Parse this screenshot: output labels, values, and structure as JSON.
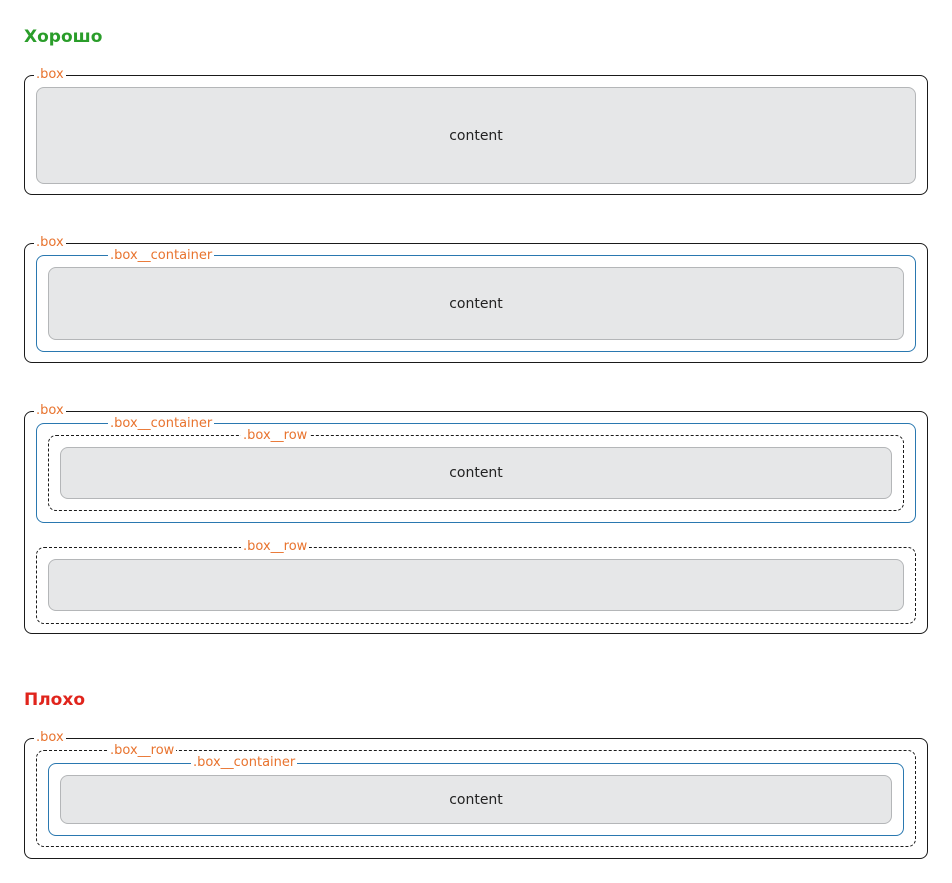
{
  "good": {
    "heading": "Хорошо",
    "heading_color": "#2a9d2a"
  },
  "bad": {
    "heading": "Плохо",
    "heading_color": "#e0241c"
  },
  "labels": {
    "box": ".box",
    "container": ".box__container",
    "row": ".box__row",
    "content": "content",
    "label_color": "#e8732e"
  },
  "colors": {
    "box_border": "#1a1a1a",
    "container_border": "#2a78b0",
    "content_fill": "#e6e7e8"
  }
}
